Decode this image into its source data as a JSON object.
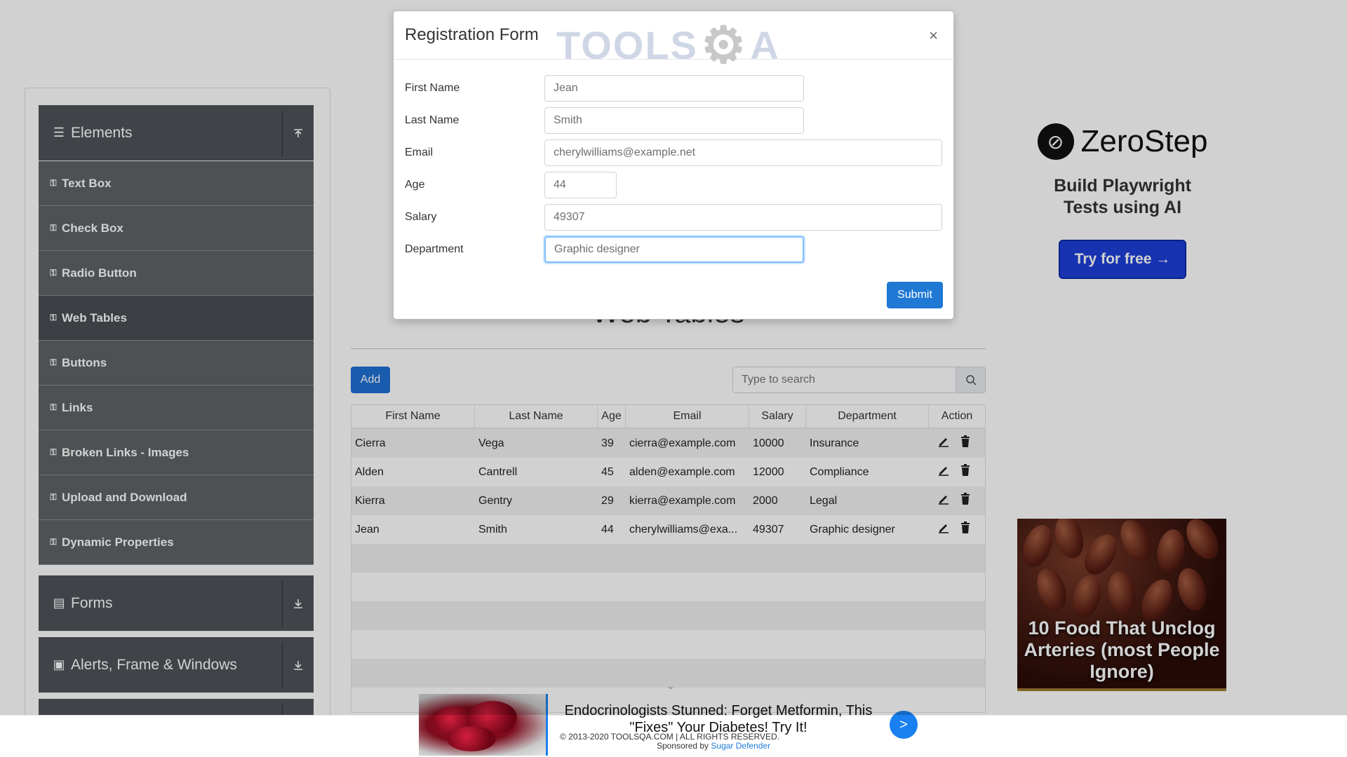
{
  "sidebar": {
    "elements_title": "Elements",
    "items": [
      {
        "label": "Text Box"
      },
      {
        "label": "Check Box"
      },
      {
        "label": "Radio Button"
      },
      {
        "label": "Web Tables"
      },
      {
        "label": "Buttons"
      },
      {
        "label": "Links"
      },
      {
        "label": "Broken Links - Images"
      },
      {
        "label": "Upload and Download"
      },
      {
        "label": "Dynamic Properties"
      }
    ],
    "forms_title": "Forms",
    "alerts_title": "Alerts, Frame & Windows",
    "active_item": "Web Tables"
  },
  "main": {
    "title": "Web Tables",
    "add_label": "Add",
    "search_placeholder": "Type to search",
    "columns": [
      "First Name",
      "Last Name",
      "Age",
      "Email",
      "Salary",
      "Department",
      "Action"
    ],
    "rows": [
      [
        "Cierra",
        "Vega",
        "39",
        "cierra@example.com",
        "10000",
        "Insurance"
      ],
      [
        "Alden",
        "Cantrell",
        "45",
        "alden@example.com",
        "12000",
        "Compliance"
      ],
      [
        "Kierra",
        "Gentry",
        "29",
        "kierra@example.com",
        "2000",
        "Legal"
      ],
      [
        "Jean",
        "Smith",
        "44",
        "cherylwilliams@exa...",
        "49307",
        "Graphic designer"
      ]
    ]
  },
  "modal": {
    "title": "Registration Form",
    "logo_text_left": "TOOLS",
    "logo_text_right": "A",
    "close": "×",
    "fields": {
      "first_name": {
        "label": "First Name",
        "value": "Jean"
      },
      "last_name": {
        "label": "Last Name",
        "value": "Smith"
      },
      "email": {
        "label": "Email",
        "value": "cherylwilliams@example.net"
      },
      "age": {
        "label": "Age",
        "value": "44"
      },
      "salary": {
        "label": "Salary",
        "value": "49307"
      },
      "department": {
        "label": "Department",
        "value": "Graphic designer"
      }
    },
    "submit_label": "Submit"
  },
  "ads": {
    "zerostep": {
      "brand": "ZeroStep",
      "headline": "Build Playwright Tests using AI",
      "cta": "Try for free →"
    },
    "dates_caption": "10 Food That Unclog Arteries (most People Ignore)",
    "banner": {
      "headline": "Endocrinologists Stunned: Forget Metformin, This \"Fixes\" Your Diabetes! Try It!",
      "copyright": "© 2013-2020 TOOLSQA.COM | ALL RIGHTS RESERVED.",
      "sponsored_prefix": "Sponsored by",
      "sponsor": "Sugar Defender",
      "go": ">"
    }
  },
  "colors": {
    "sidebar_header": "#4f5459",
    "sidebar_item": "#5f6366",
    "primary_button": "#1f6fd4",
    "focus_border": "#80bdff"
  }
}
